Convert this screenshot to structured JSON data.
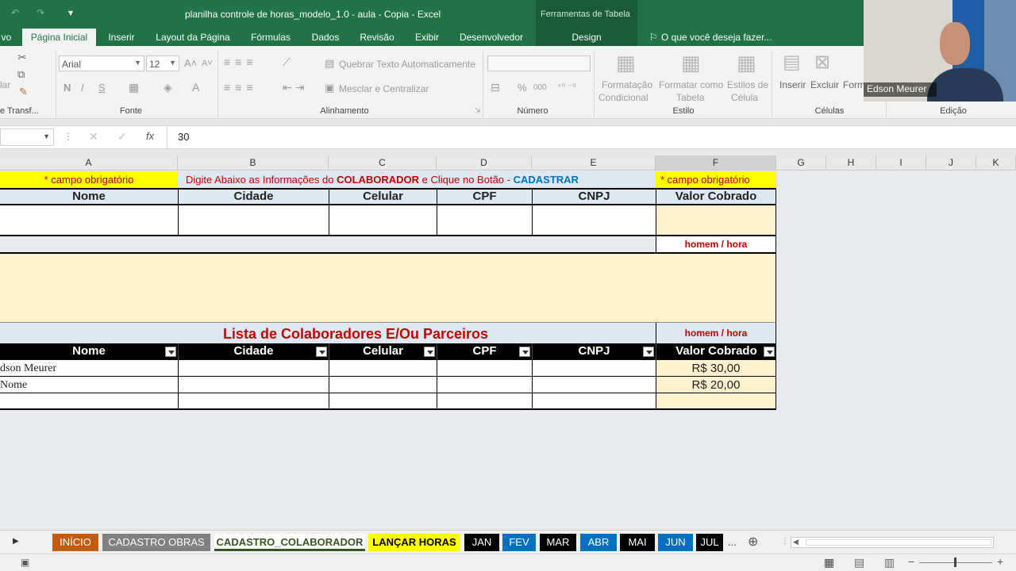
{
  "title": {
    "window": "planilha controle de horas_modelo_1.0 - aula - Copia - Excel",
    "context_label": "Ferramentas de Tabela"
  },
  "tabs": {
    "file_partial": "vo",
    "items": [
      "Página Inicial",
      "Inserir",
      "Layout da Página",
      "Fórmulas",
      "Dados",
      "Revisão",
      "Exibir",
      "Desenvolvedor",
      "Design"
    ],
    "active": "Página Inicial",
    "tell_me": "O que você deseja fazer..."
  },
  "ribbon": {
    "clipboard": {
      "paste_partial": "lar",
      "group_label": "e Transf..."
    },
    "font": {
      "name": "Arial",
      "size": "12",
      "bold": "N",
      "italic": "I",
      "underline": "S",
      "group_label": "Fonte"
    },
    "alignment": {
      "wrap_text": "Quebrar Texto Automaticamente",
      "merge_center": "Mesclar e Centralizar",
      "group_label": "Alinhamento"
    },
    "number": {
      "percent": "%",
      "thousands": "000",
      "group_label": "Número"
    },
    "style": {
      "conditional": [
        "Formatação",
        "Condicional"
      ],
      "table": [
        "Formatar como",
        "Tabela"
      ],
      "cell_styles": [
        "Estilos de",
        "Célula"
      ],
      "group_label": "Estilo"
    },
    "cells": {
      "insert": "Inserir",
      "delete": "Excluir",
      "format_partial": "Form",
      "group_label": "Células"
    },
    "editing": {
      "group_label": "Edição"
    }
  },
  "formula_bar": {
    "value": "30",
    "fx": "fx"
  },
  "webcam": {
    "name": "Edson Meurer"
  },
  "columns": [
    "A",
    "B",
    "C",
    "D",
    "E",
    "F",
    "G",
    "H",
    "I",
    "J",
    "K"
  ],
  "sheet": {
    "required_left": "* campo obrigatório",
    "instructions": {
      "prefix": "Digite Abaixo as Informações do ",
      "entity": "COLABORADOR",
      "middle": " e Clique no Botão - ",
      "action": "CADASTRAR"
    },
    "required_right": "* campo obrigatório",
    "form_headers": [
      "Nome",
      "Cidade",
      "Celular",
      "CPF",
      "CNPJ",
      "Valor Cobrado"
    ],
    "unit_label_1": "homem / hora",
    "list_title": "Lista de Colaboradores E/Ou Parceiros",
    "unit_label_2": "homem / hora",
    "table_headers": [
      "Nome",
      "Cidade",
      "Celular",
      "CPF",
      "CNPJ",
      "Valor Cobrado"
    ],
    "rows": [
      {
        "nome": "dson Meurer",
        "valor": "R$ 30,00"
      },
      {
        "nome": "Nome",
        "valor": "R$ 20,00"
      },
      {
        "nome": "",
        "valor": ""
      }
    ]
  },
  "sheet_tabs": [
    {
      "label": "INÍCIO",
      "bg": "#c55a11",
      "fg": "#ffffff"
    },
    {
      "label": "CADASTRO OBRAS",
      "bg": "#7f7f7f",
      "fg": "#ffffff"
    },
    {
      "label": "CADASTRO_COLABORADOR",
      "bg": "#ffffff",
      "fg": "#375623"
    },
    {
      "label": "LANÇAR HORAS",
      "bg": "#ffff00",
      "fg": "#000000"
    },
    {
      "label": "JAN",
      "bg": "#000000",
      "fg": "#ffffff"
    },
    {
      "label": "FEV",
      "bg": "#0070c0",
      "fg": "#ffffff"
    },
    {
      "label": "MAR",
      "bg": "#000000",
      "fg": "#ffffff"
    },
    {
      "label": "ABR",
      "bg": "#0070c0",
      "fg": "#ffffff"
    },
    {
      "label": "MAI",
      "bg": "#000000",
      "fg": "#ffffff"
    },
    {
      "label": "JUN",
      "bg": "#0070c0",
      "fg": "#ffffff"
    },
    {
      "label": "JUL",
      "bg": "#000000",
      "fg": "#ffffff"
    }
  ],
  "sheet_tabs_more": "...",
  "colors": {
    "excel_green": "#217346",
    "yellow": "#ffff00",
    "peach": "#fff2cc",
    "light_blue": "#dde8f3",
    "red_text": "#c00000",
    "blue_text": "#0070c0"
  }
}
